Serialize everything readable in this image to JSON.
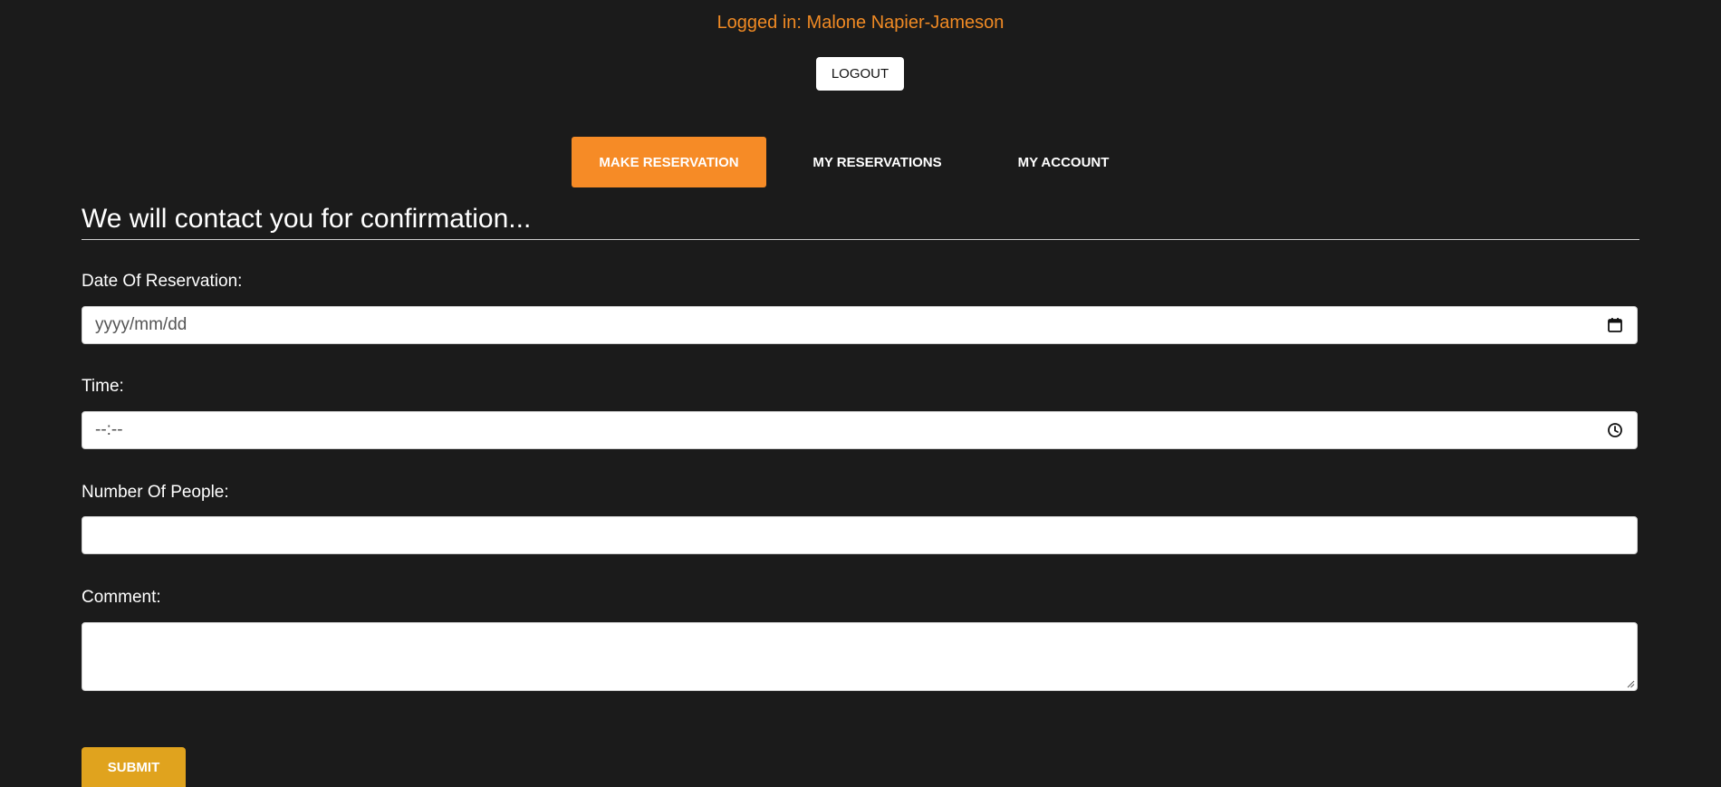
{
  "header": {
    "logged_in_text": "Logged in: Malone Napier-Jameson",
    "logout_label": "LOGOUT"
  },
  "tabs": [
    {
      "label": "MAKE RESERVATION",
      "active": true
    },
    {
      "label": "MY RESERVATIONS",
      "active": false
    },
    {
      "label": "MY ACCOUNT",
      "active": false
    }
  ],
  "form": {
    "heading": "We will contact you for confirmation...",
    "date": {
      "label": "Date Of Reservation:",
      "placeholder": "yyyy/mm/dd",
      "icon": "calendar-icon"
    },
    "time": {
      "label": "Time:",
      "placeholder": "--:--",
      "icon": "clock-icon"
    },
    "people": {
      "label": "Number Of People:",
      "value": ""
    },
    "comment": {
      "label": "Comment:",
      "value": ""
    },
    "submit_label": "SUBMIT"
  },
  "colors": {
    "background": "#1b1b1b",
    "accent_orange": "#f68b26",
    "submit_gold": "#e0a31e",
    "logged_in_text": "#f08a24"
  }
}
